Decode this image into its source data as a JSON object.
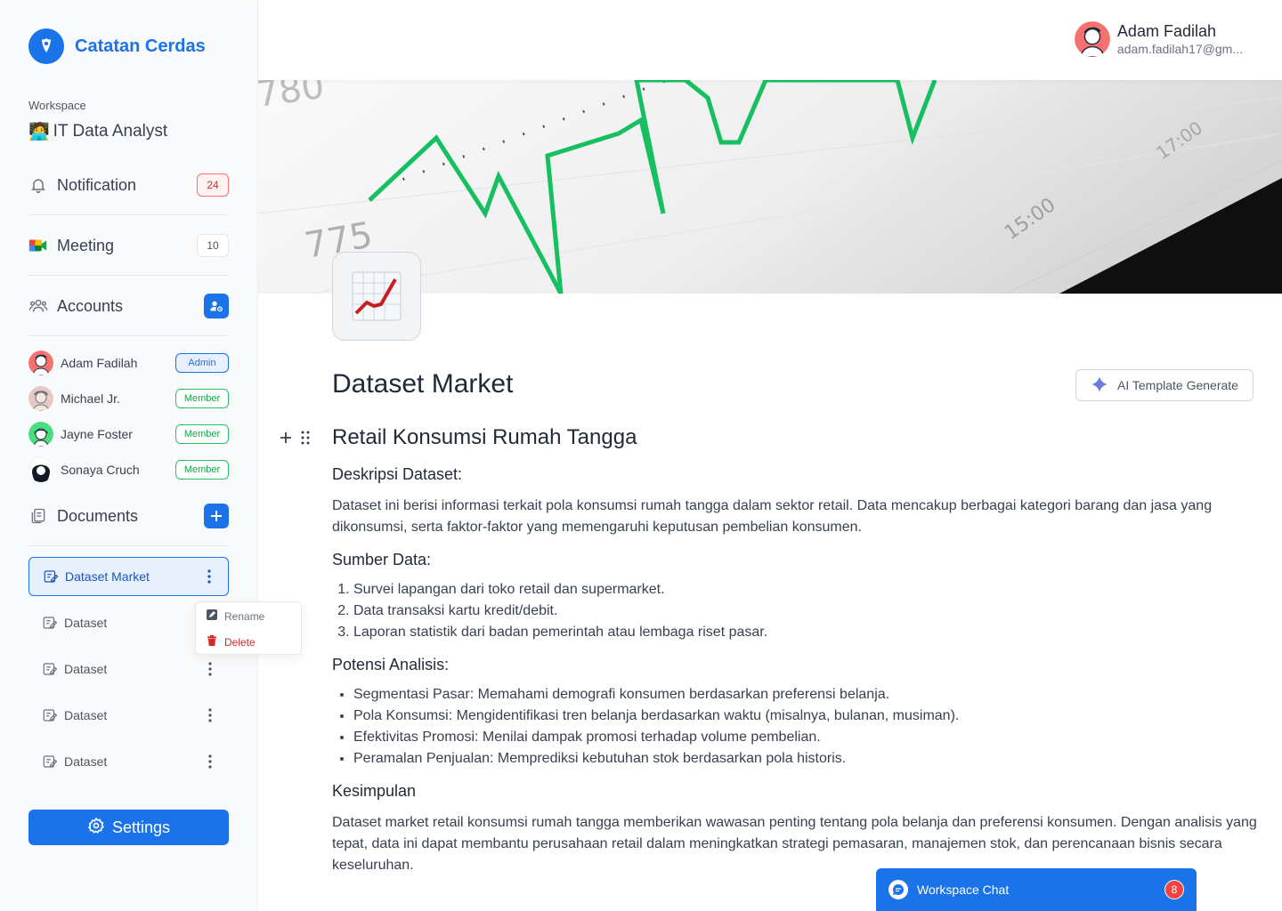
{
  "brand": {
    "name": "Catatan Cerdas"
  },
  "workspace": {
    "label": "Workspace",
    "emoji": "🧑‍💻",
    "name": "IT Data Analyst"
  },
  "nav": {
    "notification": {
      "label": "Notification",
      "count": "24"
    },
    "meeting": {
      "label": "Meeting",
      "count": "10"
    },
    "accounts": {
      "label": "Accounts"
    },
    "documents": {
      "label": "Documents"
    }
  },
  "accounts": [
    {
      "name": "Adam Fadilah",
      "role": "Admin"
    },
    {
      "name": "Michael Jr.",
      "role": "Member"
    },
    {
      "name": "Jayne Foster",
      "role": "Member"
    },
    {
      "name": "Sonaya Cruch",
      "role": "Member"
    }
  ],
  "documents": [
    {
      "label": "Dataset Market"
    },
    {
      "label": "Dataset"
    },
    {
      "label": "Dataset"
    },
    {
      "label": "Dataset"
    },
    {
      "label": "Dataset"
    }
  ],
  "context_menu": {
    "rename": "Rename",
    "delete": "Delete"
  },
  "settings": {
    "label": "Settings"
  },
  "user": {
    "name": "Adam Fadilah",
    "email": "adam.fadilah17@gm..."
  },
  "banner": {
    "tick_780": "780",
    "tick_775": "775",
    "tick_1500": "15:00",
    "tick_1700": "17:00"
  },
  "page": {
    "title": "Dataset Market",
    "ai_button": "AI Template Generate",
    "heading": "Retail Konsumsi Rumah Tangga",
    "section1_title": "Deskripsi Dataset:",
    "section1_text": "Dataset ini berisi informasi terkait pola konsumsi rumah tangga dalam sektor retail. Data mencakup berbagai kategori barang dan jasa yang dikonsumsi, serta faktor-faktor yang memengaruhi keputusan pembelian konsumen.",
    "section2_title": "Sumber Data:",
    "section2_items": [
      "Survei lapangan dari toko retail dan supermarket.",
      "Data transaksi kartu kredit/debit.",
      "Laporan statistik dari badan pemerintah atau lembaga riset pasar."
    ],
    "section3_title": "Potensi Analisis:",
    "section3_items": [
      "Segmentasi Pasar: Memahami demografi konsumen berdasarkan preferensi belanja.",
      "Pola Konsumsi: Mengidentifikasi tren belanja berdasarkan waktu (misalnya, bulanan, musiman).",
      "Efektivitas Promosi: Menilai dampak promosi terhadap volume pembelian.",
      "Peramalan Penjualan: Memprediksi kebutuhan stok berdasarkan pola historis."
    ],
    "section4_title": "Kesimpulan",
    "section4_text": "Dataset market retail konsumsi rumah tangga memberikan wawasan penting tentang pola belanja dan preferensi konsumen. Dengan analisis yang tepat, data ini dapat membantu perusahaan retail dalam meningkatkan strategi pemasaran, manajemen stok, dan perencanaan bisnis secara keseluruhan."
  },
  "chat": {
    "label": "Workspace Chat",
    "count": "8"
  },
  "colors": {
    "primary": "#1a73e8",
    "danger": "#dc2626",
    "success": "#16a34a",
    "chart_line": "#16c060"
  }
}
